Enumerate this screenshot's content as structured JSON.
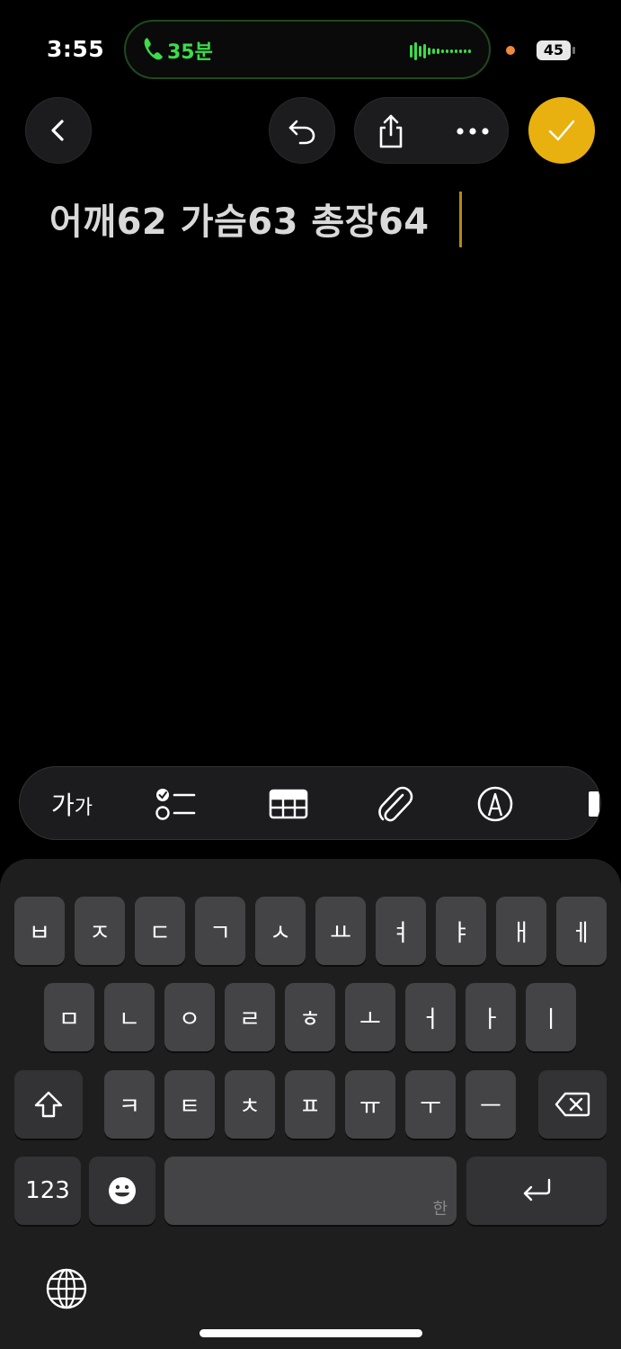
{
  "status_bar": {
    "time": "3:55",
    "call_duration": "35분",
    "battery": "45",
    "accent_call_color": "#3ddc4a",
    "privacy_dot_color": "#ef8a3c"
  },
  "nav": {
    "back_icon": "chevron-left-icon",
    "undo_icon": "undo-icon",
    "share_icon": "share-icon",
    "more_icon": "ellipsis-icon",
    "done_icon": "checkmark-icon",
    "done_color": "#e8b10f"
  },
  "note": {
    "text": "어깨62 가슴63 총장64"
  },
  "toolbar": {
    "format_label_big": "가",
    "format_label_small": "가",
    "checklist_icon": "checklist-icon",
    "table_icon": "table-icon",
    "attachment_icon": "paperclip-icon",
    "markup_icon": "markup-pen-icon"
  },
  "keyboard": {
    "row1": [
      "ㅂ",
      "ㅈ",
      "ㄷ",
      "ㄱ",
      "ㅅ",
      "ㅛ",
      "ㅕ",
      "ㅑ",
      "ㅐ",
      "ㅔ"
    ],
    "row2": [
      "ㅁ",
      "ㄴ",
      "ㅇ",
      "ㄹ",
      "ㅎ",
      "ㅗ",
      "ㅓ",
      "ㅏ",
      "ㅣ"
    ],
    "row3": [
      "ㅋ",
      "ㅌ",
      "ㅊ",
      "ㅍ",
      "ㅠ",
      "ㅜ",
      "ㅡ"
    ],
    "numbers_label": "123",
    "space_hint": "한",
    "shift_icon": "shift-icon",
    "delete_icon": "backspace-icon",
    "emoji_icon": "emoji-icon",
    "return_icon": "return-icon",
    "globe_icon": "globe-icon"
  }
}
